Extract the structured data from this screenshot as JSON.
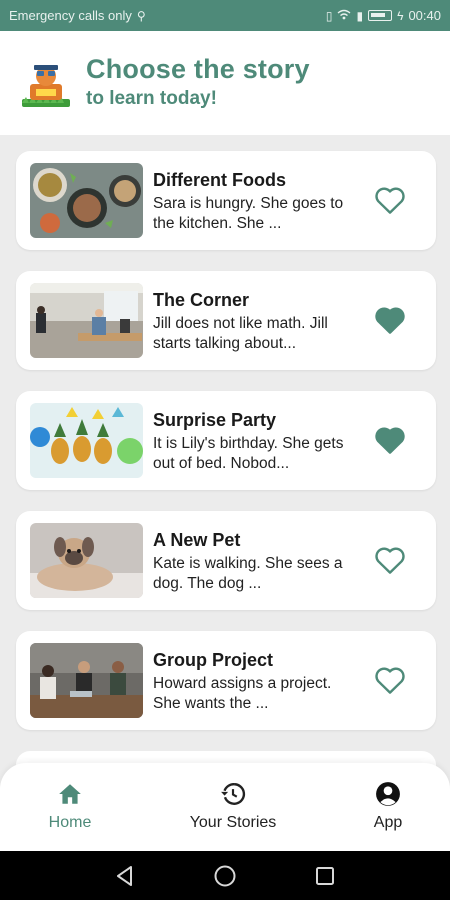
{
  "status_bar": {
    "carrier_text": "Emergency calls only",
    "time": "00:40",
    "icons": [
      "usb-icon",
      "vibrate-icon",
      "wifi-icon",
      "sim-icon",
      "battery-icon",
      "charging-icon"
    ]
  },
  "header": {
    "title": "Choose the story",
    "subtitle": "to learn today!",
    "logo_icon": "learning-logo-icon"
  },
  "stories": [
    {
      "title": "Different Foods",
      "snippet": "Sara is hungry. She goes to the kitchen. She ...",
      "favorite": false,
      "thumb": "food-bowls-photo"
    },
    {
      "title": "The Corner",
      "snippet": "Jill does not like math. Jill starts talking about...",
      "favorite": true,
      "thumb": "classroom-photo"
    },
    {
      "title": "Surprise Party",
      "snippet": "It is Lily's birthday. She gets out of bed. Nobod...",
      "favorite": true,
      "thumb": "party-pineapples-photo"
    },
    {
      "title": "A New Pet",
      "snippet": "Kate is walking. She sees a dog. The dog ...",
      "favorite": false,
      "thumb": "dog-photo"
    },
    {
      "title": "Group Project",
      "snippet": "Howard assigns a project. She wants the ...",
      "favorite": false,
      "thumb": "group-meeting-photo"
    }
  ],
  "bottom_nav": {
    "items": [
      {
        "label": "Home",
        "icon": "home-icon",
        "active": true
      },
      {
        "label": "Your Stories",
        "icon": "history-icon",
        "active": false
      },
      {
        "label": "App",
        "icon": "account-icon",
        "active": false
      }
    ]
  },
  "colors": {
    "accent": "#4e8a79",
    "background": "#ececec",
    "card": "#ffffff"
  }
}
